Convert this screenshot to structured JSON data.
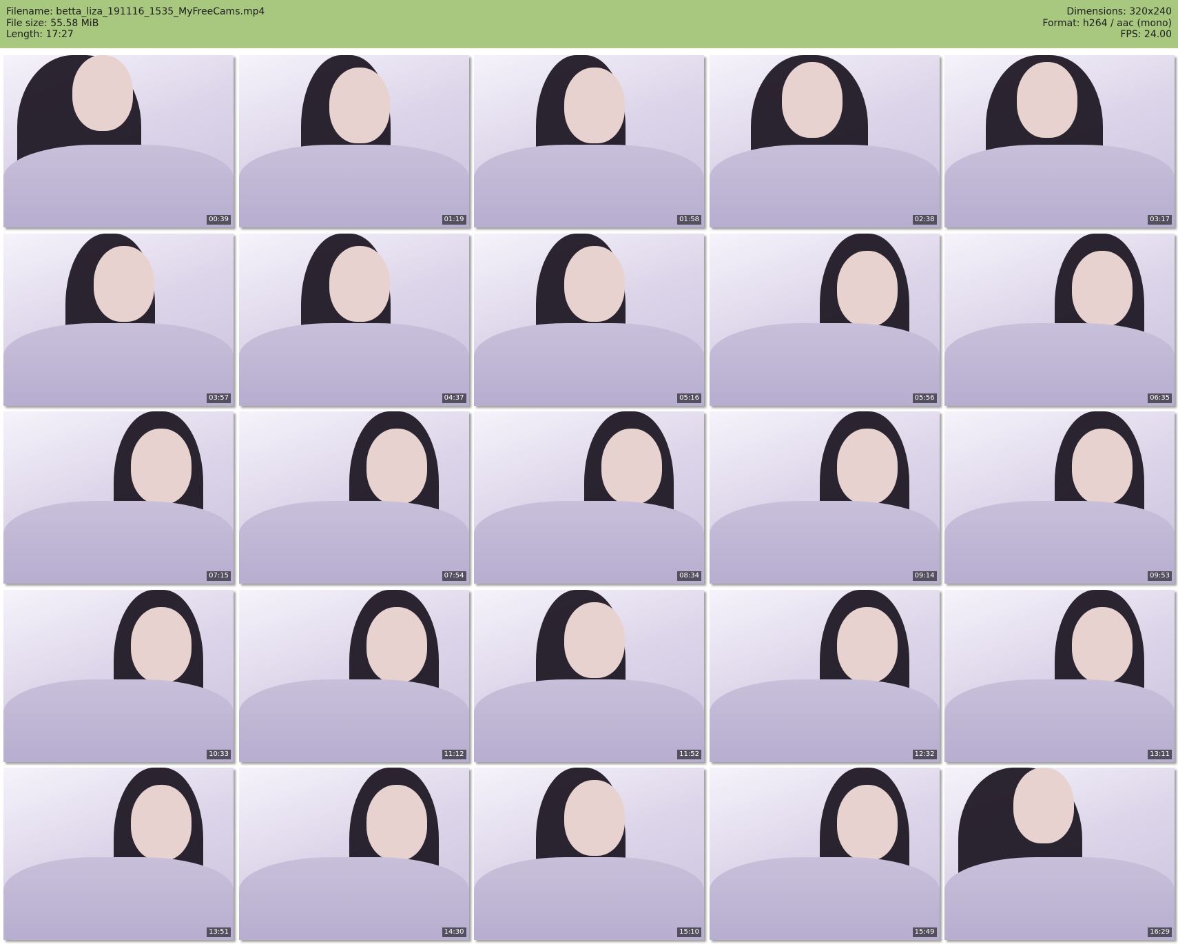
{
  "header": {
    "filename_line": "Filename: betta_liza_191116_1535_MyFreeCams.mp4",
    "filesize_line": "File size: 55.58 MiB",
    "length_line": "Length: 17:27",
    "dimensions_line": "Dimensions: 320x240",
    "format_line": "Format: h264 / aac (mono)",
    "fps_line": "FPS: 24.00",
    "background_color": "#a9c87f"
  },
  "thumbnails": [
    {
      "time": "00:39"
    },
    {
      "time": "01:19"
    },
    {
      "time": "01:58"
    },
    {
      "time": "02:38"
    },
    {
      "time": "03:17"
    },
    {
      "time": "03:57"
    },
    {
      "time": "04:37"
    },
    {
      "time": "05:16"
    },
    {
      "time": "05:56"
    },
    {
      "time": "06:35"
    },
    {
      "time": "07:15"
    },
    {
      "time": "07:54"
    },
    {
      "time": "08:34"
    },
    {
      "time": "09:14"
    },
    {
      "time": "09:53"
    },
    {
      "time": "10:33"
    },
    {
      "time": "11:12"
    },
    {
      "time": "11:52"
    },
    {
      "time": "12:32"
    },
    {
      "time": "13:11"
    },
    {
      "time": "13:51"
    },
    {
      "time": "14:30"
    },
    {
      "time": "15:10"
    },
    {
      "time": "15:49"
    },
    {
      "time": "16:29"
    }
  ]
}
